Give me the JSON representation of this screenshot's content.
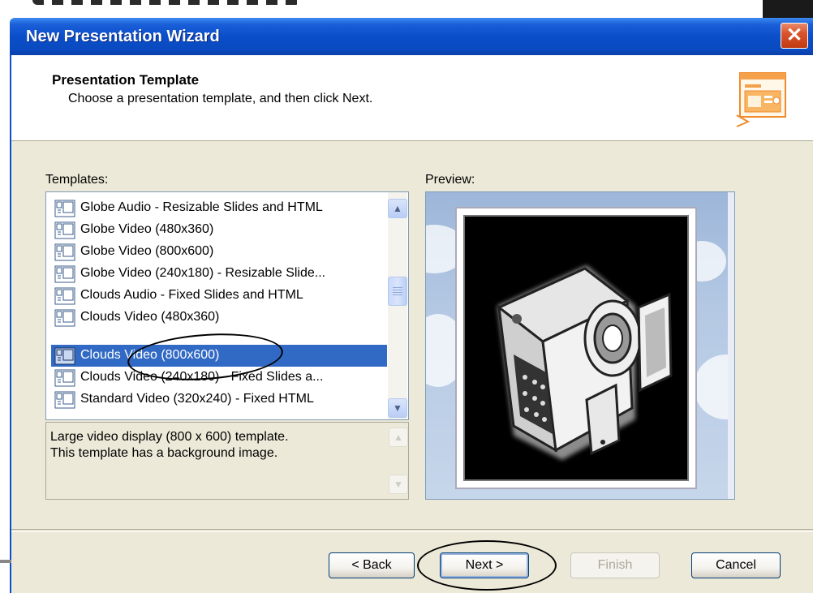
{
  "window": {
    "title": "New Presentation Wizard",
    "close_label": "✕"
  },
  "header": {
    "title": "Presentation Template",
    "subtitle": "Choose a presentation template, and then click Next."
  },
  "templates": {
    "label": "Templates:",
    "items": [
      {
        "label": "Globe Audio - Resizable Slides and HTML",
        "selected": false
      },
      {
        "label": "Globe Video (480x360)",
        "selected": false
      },
      {
        "label": "Globe Video (800x600)",
        "selected": false
      },
      {
        "label": "Globe Video (240x180) - Resizable Slide...",
        "selected": false
      },
      {
        "label": "Clouds Audio - Fixed Slides and HTML",
        "selected": false
      },
      {
        "label": "Clouds Video (480x360)",
        "selected": false
      },
      {
        "label": "Clouds Video (800x600)",
        "selected": true
      },
      {
        "label": "Clouds Video (240x180) - Fixed Slides a...",
        "selected": false
      },
      {
        "label": "Standard Video (320x240) - Fixed HTML",
        "selected": false
      }
    ],
    "description_lines": [
      "Large video display  (800 x 600) template.",
      "This template has a background image."
    ]
  },
  "preview": {
    "label": "Preview:",
    "image_icon": "video-camera-icon"
  },
  "buttons": {
    "back": "< Back",
    "next": "Next >",
    "finish": "Finish",
    "cancel": "Cancel"
  },
  "colors": {
    "title_bar": "#0a4ec9",
    "selection": "#316ac5",
    "dialog_bg": "#ece9d8"
  }
}
